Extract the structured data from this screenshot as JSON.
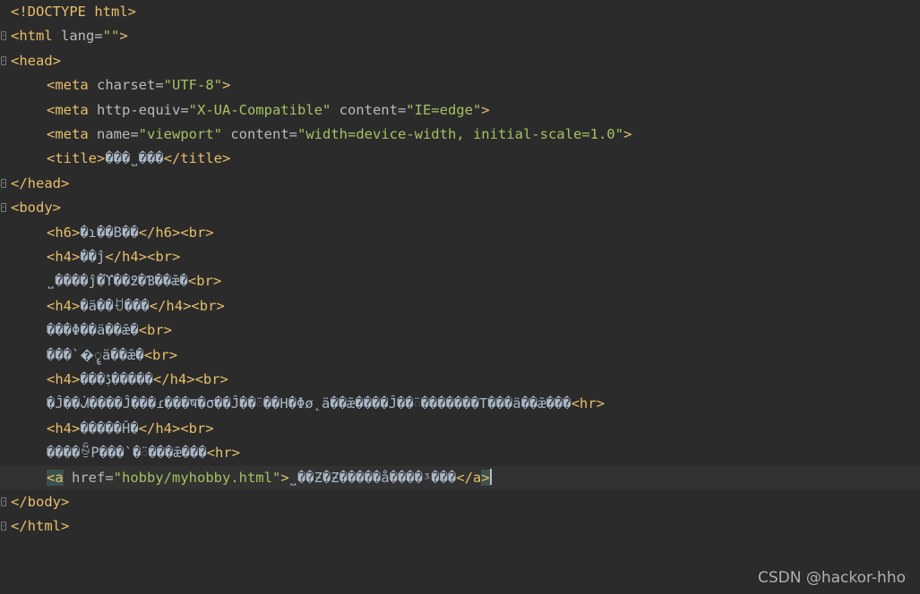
{
  "lines": [
    {
      "segs": [
        [
          "t",
          "<!DOCTYPE html>"
        ]
      ]
    },
    {
      "segs": [
        [
          "t",
          "<html "
        ],
        [
          "a",
          "lang="
        ],
        [
          "v",
          "\"\""
        ],
        [
          "t",
          ">"
        ]
      ]
    },
    {
      "segs": [
        [
          "t",
          "<head>"
        ]
      ]
    },
    {
      "segs": [
        [
          "t",
          "<meta "
        ],
        [
          "a",
          "charset="
        ],
        [
          "v",
          "\"UTF-8\""
        ],
        [
          "t",
          ">"
        ]
      ]
    },
    {
      "segs": [
        [
          "t",
          "<meta "
        ],
        [
          "a",
          "http-equiv="
        ],
        [
          "v",
          "\"X-UA-Compatible\""
        ],
        [
          "a",
          " content="
        ],
        [
          "v",
          "\"IE=edge\""
        ],
        [
          "t",
          ">"
        ]
      ]
    },
    {
      "segs": [
        [
          "t",
          "<meta "
        ],
        [
          "a",
          "name="
        ],
        [
          "v",
          "\"viewport\""
        ],
        [
          "a",
          " content="
        ],
        [
          "v",
          "\"width=device-width, initial-scale=1.0\""
        ],
        [
          "t",
          ">"
        ]
      ]
    },
    {
      "segs": [
        [
          "t",
          "<title>"
        ],
        [
          "g",
          "���˽���"
        ],
        [
          "t",
          "</title>"
        ]
      ]
    },
    {
      "segs": [
        [
          "t",
          "</head>"
        ]
      ]
    },
    {
      "segs": [
        [
          "t",
          "<body>"
        ]
      ]
    },
    {
      "segs": [
        [
          "t",
          "<h6>"
        ],
        [
          "g",
          "�ɿ��Β��"
        ],
        [
          "t",
          "</h6><br>"
        ]
      ]
    },
    {
      "segs": [
        [
          "t",
          "<h4>"
        ],
        [
          "g",
          "��ĵ"
        ],
        [
          "t",
          "</h4><br>"
        ]
      ]
    },
    {
      "segs": [
        [
          "g",
          "˽����ĵ�ϓ��߶�Ɓ��ǣ�"
        ],
        [
          "t",
          "<br>"
        ]
      ]
    },
    {
      "segs": [
        [
          "t",
          "<h4>"
        ],
        [
          "g",
          "�ä��ꀀ���"
        ],
        [
          "t",
          "</h4><br>"
        ]
      ]
    },
    {
      "segs": [
        [
          "g",
          "���Φ��ä��ǣ�"
        ],
        [
          "t",
          "<br>"
        ]
      ]
    },
    {
      "segs": [
        [
          "g",
          "���`�ॄä��ǣ�"
        ],
        [
          "t",
          "<br>"
        ]
      ]
    },
    {
      "segs": [
        [
          "t",
          "<h4>"
        ],
        [
          "g",
          "���ڋ�����"
        ],
        [
          "t",
          "</h4><br>"
        ]
      ]
    },
    {
      "segs": [
        [
          "g",
          "�Ĵ��ᣬ����Ĵ���ɾ���ष�σ��Ĵ��ᰮ��H�Φø˛ä��ǣ����Ĵ��ᰮ�������T���ä��ǣ���"
        ],
        [
          "t",
          "<hr>"
        ]
      ]
    },
    {
      "segs": [
        [
          "t",
          "<h4>"
        ],
        [
          "g",
          "�����Ȟ�"
        ],
        [
          "t",
          "</h4><br>"
        ]
      ]
    },
    {
      "segs": [
        [
          "g",
          "����ꁩΡ���`�ᰮ���ǣ���"
        ],
        [
          "t",
          "<hr>"
        ]
      ]
    },
    {
      "current": true,
      "segs": [
        [
          "hl",
          "<a"
        ],
        [
          "a",
          " href="
        ],
        [
          "v",
          "\"hobby/myhobby.html\""
        ],
        [
          "t",
          ">"
        ],
        [
          "g",
          "˽��Ƶ�Ƶ�����å����ᶾ���"
        ],
        [
          "t",
          "</a"
        ],
        [
          "hl",
          ">"
        ]
      ]
    },
    {
      "segs": [
        [
          "t",
          "</body>"
        ]
      ]
    },
    {
      "segs": [
        [
          "t",
          "</html>"
        ]
      ]
    }
  ],
  "watermark": "CSDN @hackor-hho"
}
